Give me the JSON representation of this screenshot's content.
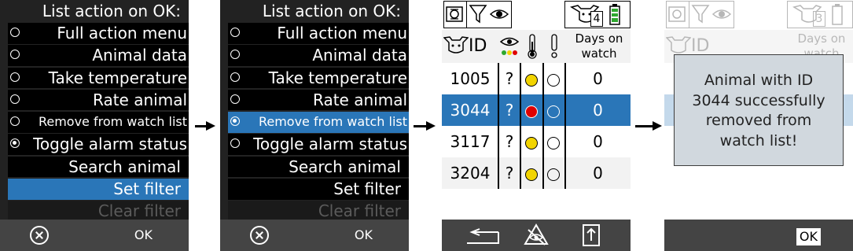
{
  "panel1": {
    "title": "List action on OK:",
    "items": [
      {
        "label": "Full action menu",
        "radio": "off"
      },
      {
        "label": "Animal data",
        "radio": "off"
      },
      {
        "label": "Take temperature",
        "radio": "off"
      },
      {
        "label": "Rate animal",
        "radio": "off"
      },
      {
        "label": "Remove from watch list",
        "radio": "off"
      },
      {
        "label": "Toggle alarm status",
        "radio": "on"
      },
      {
        "label": "Search animal"
      },
      {
        "label": "Set filter",
        "selected": true
      },
      {
        "label": "Clear filter",
        "disabled": true
      }
    ],
    "softkey_ok": "OK"
  },
  "panel2": {
    "title": "List action on OK:",
    "items": [
      {
        "label": "Full action menu",
        "radio": "off"
      },
      {
        "label": "Animal data",
        "radio": "off"
      },
      {
        "label": "Take temperature",
        "radio": "off"
      },
      {
        "label": "Rate animal",
        "radio": "off"
      },
      {
        "label": "Remove from watch list",
        "radio": "on",
        "selected": true
      },
      {
        "label": "Toggle alarm status",
        "radio": "off"
      },
      {
        "label": "Search animal"
      },
      {
        "label": "Set filter"
      },
      {
        "label": "Clear filter",
        "disabled": true
      }
    ],
    "softkey_ok": "OK"
  },
  "panel3": {
    "count_badge": "4",
    "columns": {
      "id": "ID",
      "days_line1": "Days on",
      "days_line2": "watch"
    },
    "rows": [
      {
        "id": "1005",
        "rating": "?",
        "temp": "yellow",
        "alarm": "empty",
        "days": "0"
      },
      {
        "id": "3044",
        "rating": "?",
        "temp": "red",
        "alarm": "empty",
        "days": "0",
        "selected": true
      },
      {
        "id": "3117",
        "rating": "?",
        "temp": "yellow",
        "alarm": "empty",
        "days": "0"
      },
      {
        "id": "3204",
        "rating": "?",
        "temp": "yellow",
        "alarm": "empty",
        "days": "0"
      }
    ],
    "softkeys": [
      "back-arrow-icon",
      "eye-off-icon",
      "export-icon"
    ]
  },
  "panel4": {
    "count_badge": "3",
    "background_id": "ID",
    "background_days": "Days on",
    "background_days2": "watch",
    "message": [
      "Animal with ID",
      "3044 successfully",
      "removed from",
      "watch list!"
    ],
    "softkey_ok": "OK"
  },
  "colors": {
    "menu_bg": "#222222",
    "selected": "#2a76b8",
    "softbar": "#444444",
    "temp_yellow": "#f2d400",
    "temp_red": "#e00000",
    "dialog_bg": "#d1d8de"
  }
}
